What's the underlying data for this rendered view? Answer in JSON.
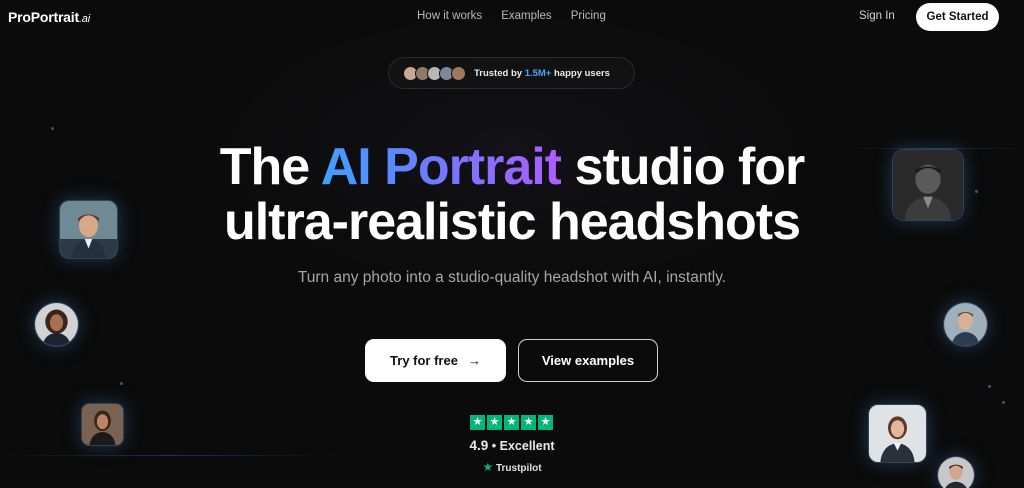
{
  "nav": {
    "logo": "ProPortrait",
    "logo_suffix": ".ai",
    "links": [
      "How it works",
      "Examples",
      "Pricing"
    ],
    "sign_in": "Sign In",
    "cta": "Get Started"
  },
  "trusted": {
    "prefix": "Trusted by",
    "count": "1.5M+",
    "suffix": "happy users",
    "avatar_colors": [
      "#c9a88f",
      "#8e7a6b",
      "#b7b7b7",
      "#7a8a99",
      "#a07860"
    ]
  },
  "hero": {
    "line1_pre": "The",
    "line1_highlight": "AI Portrait",
    "line1_post": "studio for",
    "line2": "ultra-realistic headshots",
    "subtitle": "Turn any photo into a studio-quality headshot with AI, instantly."
  },
  "buttons": {
    "primary": "Try for free",
    "primary_icon": "→",
    "secondary": "View examples"
  },
  "rating": {
    "stars": 5,
    "score": "4.9",
    "separator": "•",
    "label": "Excellent",
    "platform": "Trustpilot",
    "star_color": "#00b67a"
  },
  "colors": {
    "background": "#0b0b0b",
    "gradient_start": "#3fa0ff",
    "gradient_end": "#b05cff",
    "accent_blue": "#4aa3ff"
  }
}
